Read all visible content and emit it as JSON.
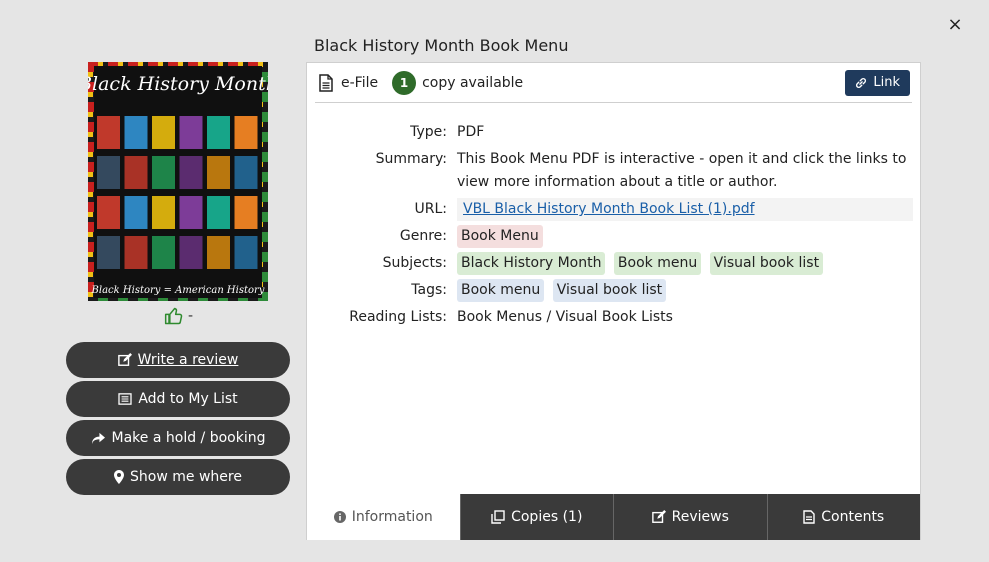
{
  "dialog": {
    "close_label": "×"
  },
  "record": {
    "title": "Black History Month Book Menu",
    "cover_title": "Black History Month",
    "cover_subtitle": "Black History = American History",
    "likes": "-"
  },
  "actions": {
    "write_review": "Write a review",
    "add_to_list": "Add to My List",
    "hold": "Make a hold / booking",
    "show_where": "Show me where"
  },
  "availability": {
    "format": "e-File",
    "count": "1",
    "text": "copy available",
    "link_label": "Link"
  },
  "details": {
    "type_label": "Type:",
    "type_value": "PDF",
    "summary_label": "Summary:",
    "summary_value": "This Book Menu PDF is interactive - open it and click the links to view more information about a title or author.",
    "url_label": "URL:",
    "url_value": "VBL Black History Month Book List (1).pdf",
    "genre_label": "Genre:",
    "genres": [
      "Book Menu"
    ],
    "subjects_label": "Subjects:",
    "subjects": [
      "Black History Month",
      "Book menu",
      "Visual book list"
    ],
    "tags_label": "Tags:",
    "tags": [
      "Book menu",
      "Visual book list"
    ],
    "lists_label": "Reading Lists:",
    "lists_value": "Book Menus / Visual Book Lists"
  },
  "tabs": {
    "information": "Information",
    "copies": "Copies (1)",
    "reviews": "Reviews",
    "contents": "Contents"
  },
  "colors": {
    "button_bg": "#3a3a3a",
    "link_btn_bg": "#1f3a5c",
    "badge_green": "#2f6b2a",
    "genre_chip": "#f4dede",
    "subject_chip": "#d9ecd4",
    "tag_chip": "#dde6f2"
  }
}
